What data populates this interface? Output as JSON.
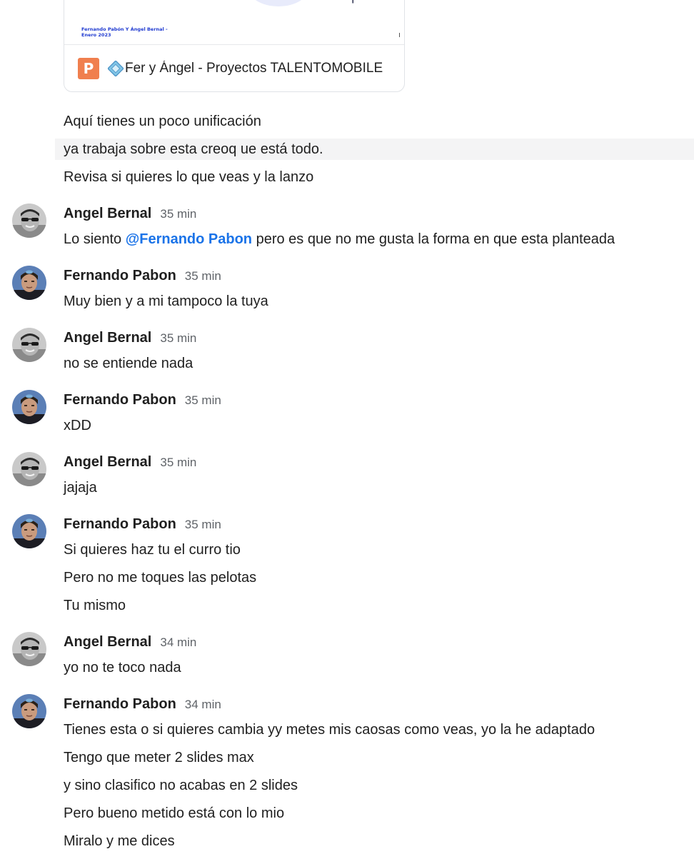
{
  "attachment": {
    "preview_caption_line1": "Fernando Pabón  Y Ángel Bernal -",
    "preview_caption_line2": "Enero 2023",
    "file_type_letter": "P",
    "title": "Fer y Ángel - Proyectos TALENTOMOBILE",
    "icon": "google-slides-icon",
    "accent_color": "#f07f4e"
  },
  "continuation": [
    "Aquí tienes un poco unificación",
    "ya trabaja sobre esta creoq ue está todo.",
    "Revisa si quieres lo que veas y la lanzo"
  ],
  "colors": {
    "mention": "#1a73e8",
    "timestamp": "#5f6368",
    "hover_row": "#f4f4f5"
  },
  "messages": [
    {
      "sender": "Angel Bernal",
      "time": "35 min",
      "lines": [
        {
          "before": "Lo siento ",
          "mention": "@Fernando Pabon",
          "after": " pero es que no me gusta la forma en que esta planteada"
        }
      ]
    },
    {
      "sender": "Fernando Pabon",
      "time": "35 min",
      "lines": [
        {
          "text": "Muy bien y a mi tampoco la tuya"
        }
      ]
    },
    {
      "sender": "Angel Bernal",
      "time": "35 min",
      "lines": [
        {
          "text": "no se entiende nada"
        }
      ]
    },
    {
      "sender": "Fernando Pabon",
      "time": "35 min",
      "lines": [
        {
          "text": "xDD"
        }
      ]
    },
    {
      "sender": "Angel Bernal",
      "time": "35 min",
      "lines": [
        {
          "text": "jajaja"
        }
      ]
    },
    {
      "sender": "Fernando Pabon",
      "time": "35 min",
      "lines": [
        {
          "text": "Si quieres haz tu el curro tio"
        },
        {
          "text": "Pero no me toques las pelotas"
        },
        {
          "text": "Tu mismo"
        }
      ]
    },
    {
      "sender": "Angel Bernal",
      "time": "34 min",
      "lines": [
        {
          "text": "yo no te toco nada"
        }
      ]
    },
    {
      "sender": "Fernando Pabon",
      "time": "34 min",
      "lines": [
        {
          "text": "Tienes esta o si quieres cambia yy metes mis caosas como veas, yo la he adaptado"
        },
        {
          "text": "Tengo que meter 2 slides max"
        },
        {
          "text": "y sino clasifico no acabas en 2 slides"
        },
        {
          "text": "Pero bueno metido está con lo mio"
        },
        {
          "text": "Miralo y me dices"
        }
      ]
    }
  ]
}
